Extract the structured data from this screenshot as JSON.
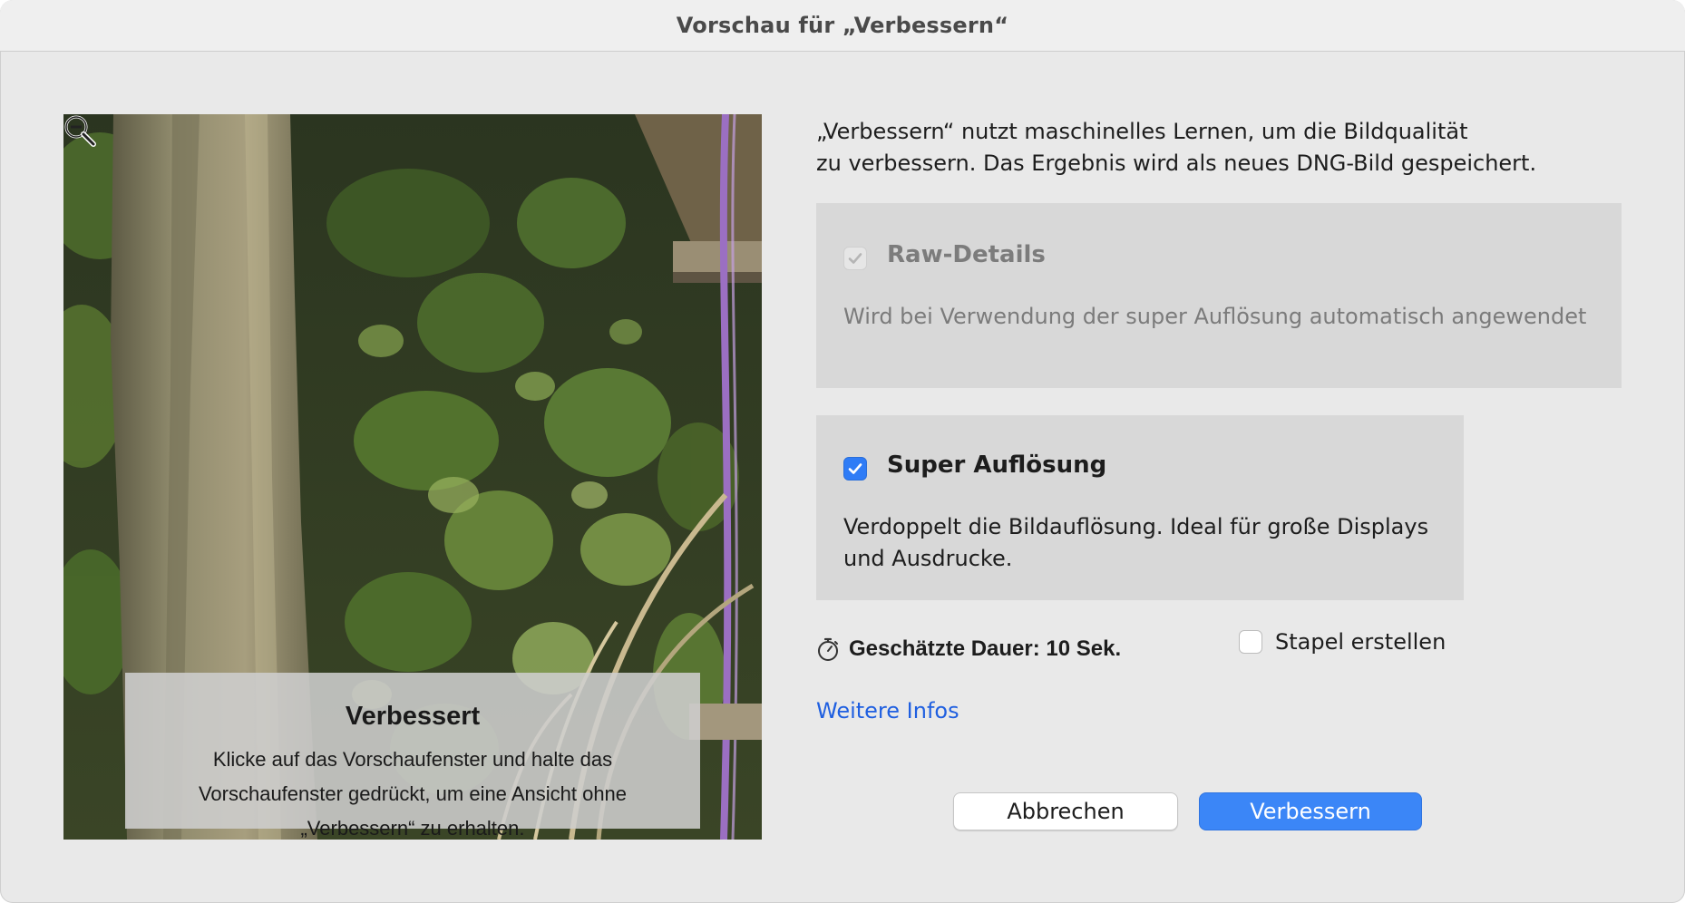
{
  "window": {
    "title": "Vorschau für „Verbessern“"
  },
  "preview": {
    "overlay_title": "Verbessert",
    "overlay_description": "Klicke auf das Vorschaufenster und halte das Vorschaufenster gedrückt, um eine Ansicht ohne „Verbessern“ zu erhalten.",
    "zoom_icon": "zoom-out-icon"
  },
  "intro": {
    "line1": "„Verbessern“ nutzt maschinelles Lernen, um die Bildqualität",
    "line2": "zu verbessern. Das Ergebnis wird als neues DNG-Bild gespeichert."
  },
  "options": {
    "raw_details": {
      "label": "Raw-Details",
      "description": "Wird bei Verwendung der super Auflösung automatisch angewendet",
      "checked": true,
      "disabled": true
    },
    "super_resolution": {
      "label": "Super Auflösung",
      "description_line1": "Verdoppelt die Bildauflösung. Ideal für große Displays",
      "description_line2": "und Ausdrucke.",
      "checked": true
    }
  },
  "duration": {
    "icon": "stopwatch-icon",
    "text": "Geschätzte Dauer: 10 Sek."
  },
  "stack": {
    "label": "Stapel erstellen",
    "checked": false
  },
  "more_info": {
    "label": "Weitere Infos"
  },
  "buttons": {
    "cancel": "Abbrechen",
    "enhance": "Verbessern"
  },
  "colors": {
    "accent": "#3b86f7",
    "link": "#1f5fe0",
    "panel_background": "#d8d8d8",
    "window_background": "#e9e9e9"
  }
}
